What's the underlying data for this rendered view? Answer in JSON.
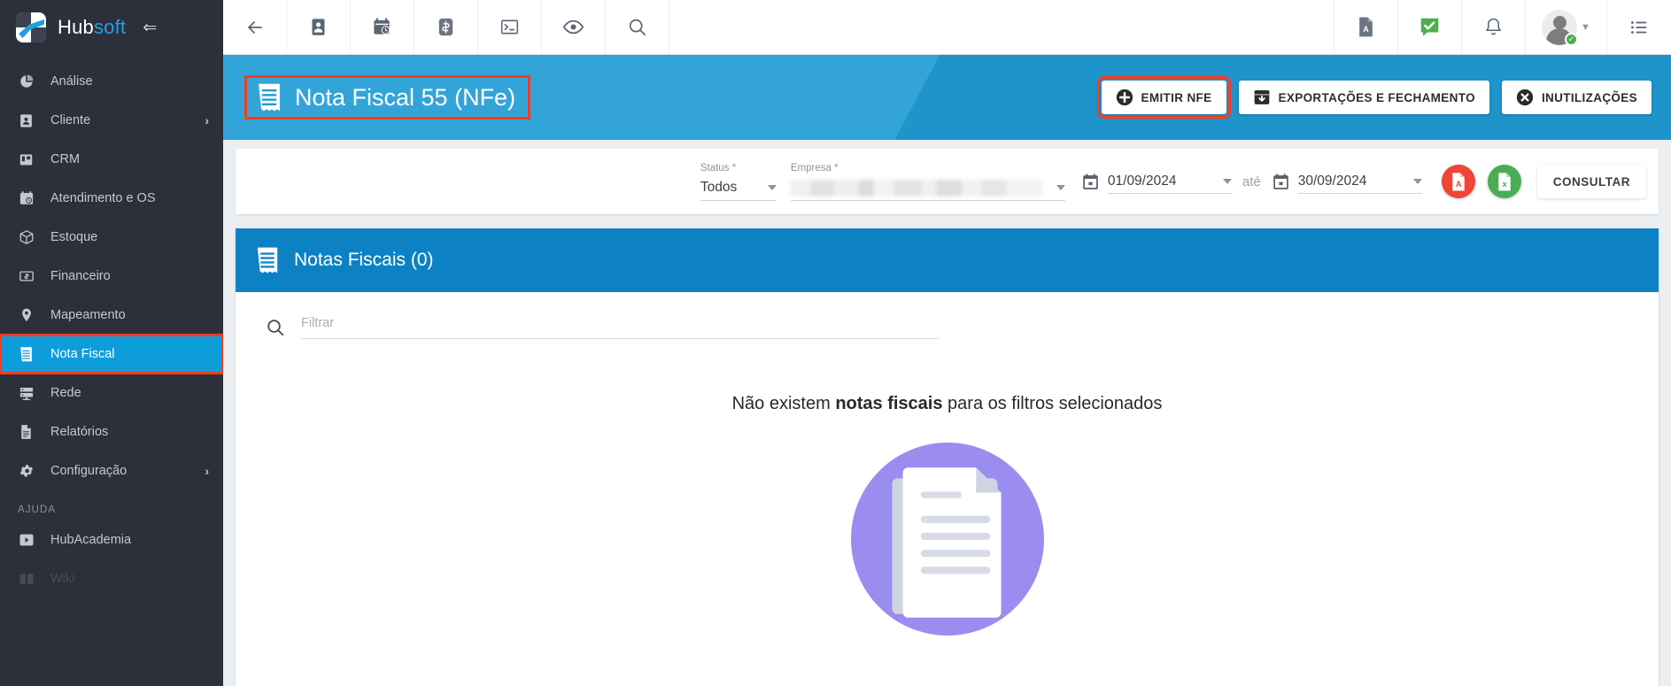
{
  "brand": {
    "name_first": "Hub",
    "name_second": "soft",
    "collapse_icon": "collapse-left-icon"
  },
  "sidebar": {
    "items": [
      {
        "label": "Análise",
        "icon": "pie-chart-icon",
        "has_chevron": false,
        "active": false
      },
      {
        "label": "Cliente",
        "icon": "user-badge-icon",
        "has_chevron": true,
        "active": false
      },
      {
        "label": "CRM",
        "icon": "kanban-board-icon",
        "has_chevron": false,
        "active": false
      },
      {
        "label": "Atendimento e OS",
        "icon": "calendar-clock-icon",
        "has_chevron": false,
        "active": false
      },
      {
        "label": "Estoque",
        "icon": "box-package-icon",
        "has_chevron": false,
        "active": false
      },
      {
        "label": "Financeiro",
        "icon": "money-bill-icon",
        "has_chevron": false,
        "active": false
      },
      {
        "label": "Mapeamento",
        "icon": "map-pin-icon",
        "has_chevron": false,
        "active": false
      },
      {
        "label": "Nota Fiscal",
        "icon": "receipt-icon",
        "has_chevron": false,
        "active": true
      },
      {
        "label": "Rede",
        "icon": "server-rack-icon",
        "has_chevron": false,
        "active": false
      },
      {
        "label": "Relatórios",
        "icon": "document-icon",
        "has_chevron": false,
        "active": false
      },
      {
        "label": "Configuração",
        "icon": "gear-icon",
        "has_chevron": true,
        "active": false
      }
    ],
    "section_label": "AJUDA",
    "help_items": [
      {
        "label": "HubAcademia",
        "icon": "video-play-icon"
      },
      {
        "label": "Wiki",
        "icon": "wiki-book-icon"
      }
    ],
    "chevron_glyph": "›"
  },
  "topbar": {
    "left_icons": [
      "back-arrow-icon",
      "contact-card-icon",
      "calendar-clock-icon",
      "dollar-bill-icon",
      "terminal-icon",
      "eye-icon",
      "search-icon"
    ],
    "right_icons": [
      "pdf-file-icon",
      "green-check-chat-icon",
      "bell-notification-icon"
    ],
    "avatar": "user-avatar",
    "avatar_status": "online-badge",
    "avatar_caret": "chevron-down-icon",
    "menu_icon": "list-menu-icon"
  },
  "page_header": {
    "icon": "receipt-icon",
    "title": "Nota Fiscal 55 (NFe)",
    "highlight_color": "#fb3b1e",
    "background_color": "#1f9bd4",
    "actions": [
      {
        "label": "EMITIR NFE",
        "icon": "plus-circle-icon",
        "highlighted": true
      },
      {
        "label": "EXPORTAÇÕES E FECHAMENTO",
        "icon": "archive-down-icon",
        "highlighted": false
      },
      {
        "label": "INUTILIZAÇÕES",
        "icon": "x-circle-icon",
        "highlighted": false
      }
    ]
  },
  "filters": {
    "status": {
      "label": "Status *",
      "value": "Todos"
    },
    "empresa": {
      "label": "Empresa *",
      "value": "",
      "redacted": true
    },
    "date_from": {
      "value": "01/09/2024",
      "icon": "calendar-icon"
    },
    "separator": "até",
    "date_to": {
      "value": "30/09/2024",
      "icon": "calendar-icon"
    },
    "export_pdf": {
      "icon": "pdf-export-icon",
      "color": "#ef4436"
    },
    "export_excel": {
      "icon": "excel-export-icon",
      "color": "#4aad54"
    },
    "submit": "CONSULTAR"
  },
  "results": {
    "header_icon": "receipt-icon",
    "header_title": "Notas Fiscais (0)",
    "header_color": "#0c82c4",
    "search_placeholder": "Filtrar",
    "empty_text_before": "Não existem ",
    "empty_text_bold": "notas fiscais",
    "empty_text_after": " para os filtros selecionados",
    "empty_illustration": "documents-placeholder-icon",
    "empty_illustration_color": "#9b8cf0"
  }
}
